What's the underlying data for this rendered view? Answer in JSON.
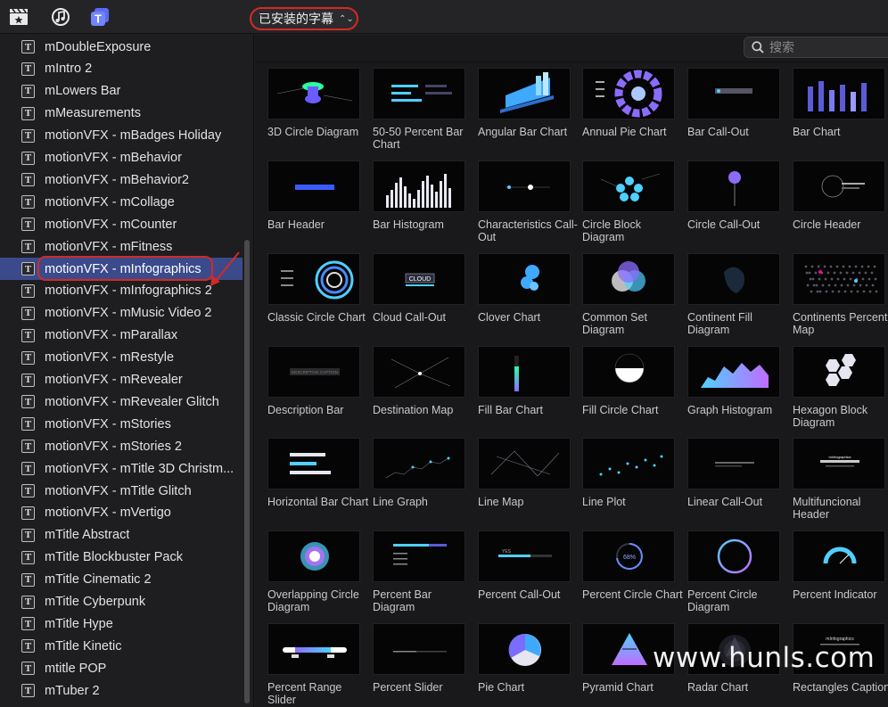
{
  "toolbar": {
    "dropdown_label": "已安装的字幕",
    "icons": [
      "clapperboard-star-icon",
      "music-photo-icon",
      "titles-icon"
    ]
  },
  "search": {
    "placeholder": "搜索"
  },
  "sidebar": {
    "items": [
      {
        "label": "mDoubleExposure"
      },
      {
        "label": "mIntro 2"
      },
      {
        "label": "mLowers Bar"
      },
      {
        "label": "mMeasurements"
      },
      {
        "label": "motionVFX - mBadges Holiday"
      },
      {
        "label": "motionVFX - mBehavior"
      },
      {
        "label": "motionVFX - mBehavior2"
      },
      {
        "label": "motionVFX - mCollage"
      },
      {
        "label": "motionVFX - mCounter"
      },
      {
        "label": "motionVFX - mFitness"
      },
      {
        "label": "motionVFX - mInfographics",
        "selected": true
      },
      {
        "label": "motionVFX - mInfographics 2"
      },
      {
        "label": "motionVFX - mMusic Video 2"
      },
      {
        "label": "motionVFX - mParallax"
      },
      {
        "label": "motionVFX - mRestyle"
      },
      {
        "label": "motionVFX - mRevealer"
      },
      {
        "label": "motionVFX - mRevealer Glitch"
      },
      {
        "label": "motionVFX - mStories"
      },
      {
        "label": "motionVFX - mStories 2"
      },
      {
        "label": "motionVFX - mTitle 3D Christm..."
      },
      {
        "label": "motionVFX - mTitle Glitch"
      },
      {
        "label": "motionVFX - mVertigo"
      },
      {
        "label": "mTitle Abstract"
      },
      {
        "label": "mTitle Blockbuster Pack"
      },
      {
        "label": "mTitle Cinematic 2"
      },
      {
        "label": "mTitle Cyberpunk"
      },
      {
        "label": "mTitle Hype"
      },
      {
        "label": "mTitle Kinetic"
      },
      {
        "label": "mtitle POP"
      },
      {
        "label": "mTuber 2"
      }
    ]
  },
  "grid": {
    "items": [
      {
        "label": "3D Circle Diagram"
      },
      {
        "label": "50-50 Percent Bar Chart"
      },
      {
        "label": "Angular Bar Chart"
      },
      {
        "label": "Annual Pie Chart"
      },
      {
        "label": "Bar Call-Out"
      },
      {
        "label": "Bar Chart"
      },
      {
        "label": "Bar Header"
      },
      {
        "label": "Bar Histogram"
      },
      {
        "label": "Characteristics Call-Out"
      },
      {
        "label": "Circle Block Diagram"
      },
      {
        "label": "Circle Call-Out"
      },
      {
        "label": "Circle Header"
      },
      {
        "label": "Classic Circle Chart"
      },
      {
        "label": "Cloud Call-Out"
      },
      {
        "label": "Clover Chart"
      },
      {
        "label": "Common Set Diagram"
      },
      {
        "label": "Continent Fill Diagram"
      },
      {
        "label": "Continents Percent Map"
      },
      {
        "label": "Description Bar"
      },
      {
        "label": "Destination Map"
      },
      {
        "label": "Fill Bar Chart"
      },
      {
        "label": "Fill Circle Chart"
      },
      {
        "label": "Graph Histogram"
      },
      {
        "label": "Hexagon Block Diagram"
      },
      {
        "label": "Horizontal Bar Chart"
      },
      {
        "label": "Line Graph"
      },
      {
        "label": "Line Map"
      },
      {
        "label": "Line Plot"
      },
      {
        "label": "Linear Call-Out"
      },
      {
        "label": "Multifuncional Header"
      },
      {
        "label": "Overlapping Circle Diagram"
      },
      {
        "label": "Percent Bar Diagram"
      },
      {
        "label": "Percent Call-Out"
      },
      {
        "label": "Percent Circle Chart"
      },
      {
        "label": "Percent Circle Diagram"
      },
      {
        "label": "Percent Indicator"
      },
      {
        "label": "Percent Range Slider"
      },
      {
        "label": "Percent Slider"
      },
      {
        "label": "Pie Chart"
      },
      {
        "label": "Pyramid Chart"
      },
      {
        "label": "Radar Chart"
      },
      {
        "label": "Rectangles Caption"
      }
    ]
  },
  "thumb_texts": {
    "cloud": "CLOUD",
    "desc": "DESCRIPTIVE CAPTION",
    "pct68": "68%",
    "infographics": "mInfographics",
    "yes": "YES"
  },
  "watermark": "www.hunls.com",
  "colors": {
    "accent_selected": "#3b4a8b",
    "annotation_red": "#d42a24",
    "cyan": "#4fd0ff",
    "violet": "#8c6cff"
  }
}
